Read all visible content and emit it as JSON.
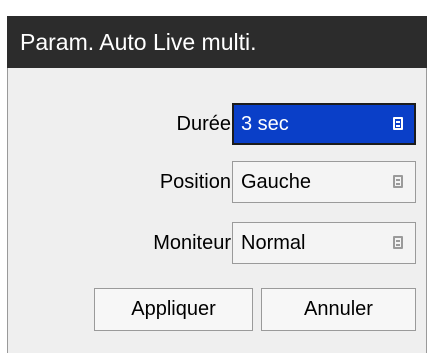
{
  "dialog": {
    "title": "Param. Auto Live multi."
  },
  "fields": [
    {
      "label": "Durée",
      "value": "3 sec",
      "focused": true,
      "icon": "list-icon"
    },
    {
      "label": "Position",
      "value": "Gauche",
      "focused": false,
      "icon": "list-icon"
    },
    {
      "label": "Moniteur",
      "value": "Normal",
      "focused": false,
      "icon": "list-icon"
    }
  ],
  "buttons": {
    "apply_label": "Appliquer",
    "cancel_label": "Annuler"
  },
  "colors": {
    "title_background": "#2c2c2c",
    "dialog_background": "#efefef",
    "focus_highlight": "#0a3fc8"
  }
}
